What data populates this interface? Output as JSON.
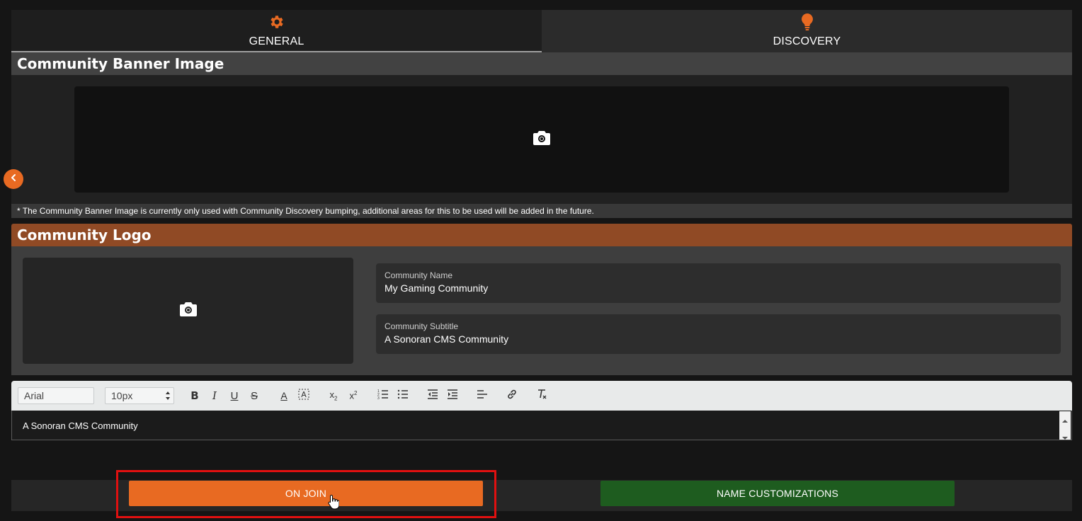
{
  "tabs": [
    {
      "label": "GENERAL",
      "icon": "gear-icon",
      "active": true
    },
    {
      "label": "DISCOVERY",
      "icon": "lightbulb-icon",
      "active": false
    }
  ],
  "banner": {
    "title": "Community Banner Image",
    "icon": "camera-icon",
    "note": "* The Community Banner Image is currently only used with Community Discovery bumping, additional areas for this to be used will be added in the future."
  },
  "logo": {
    "title": "Community Logo",
    "icon": "camera-icon"
  },
  "fields": {
    "name": {
      "label": "Community Name",
      "value": "My Gaming Community"
    },
    "subtitle": {
      "label": "Community Subtitle",
      "value": "A Sonoran CMS Community"
    }
  },
  "editor": {
    "font": "Arial",
    "size": "10px",
    "content": "A Sonoran CMS Community"
  },
  "buttons": {
    "on_join": "ON JOIN",
    "name_customizations": "NAME CUSTOMIZATIONS"
  },
  "colors": {
    "accent": "#e86a22",
    "logo_header": "#904a25",
    "green": "#1e5c1f",
    "highlight": "#e01010"
  }
}
